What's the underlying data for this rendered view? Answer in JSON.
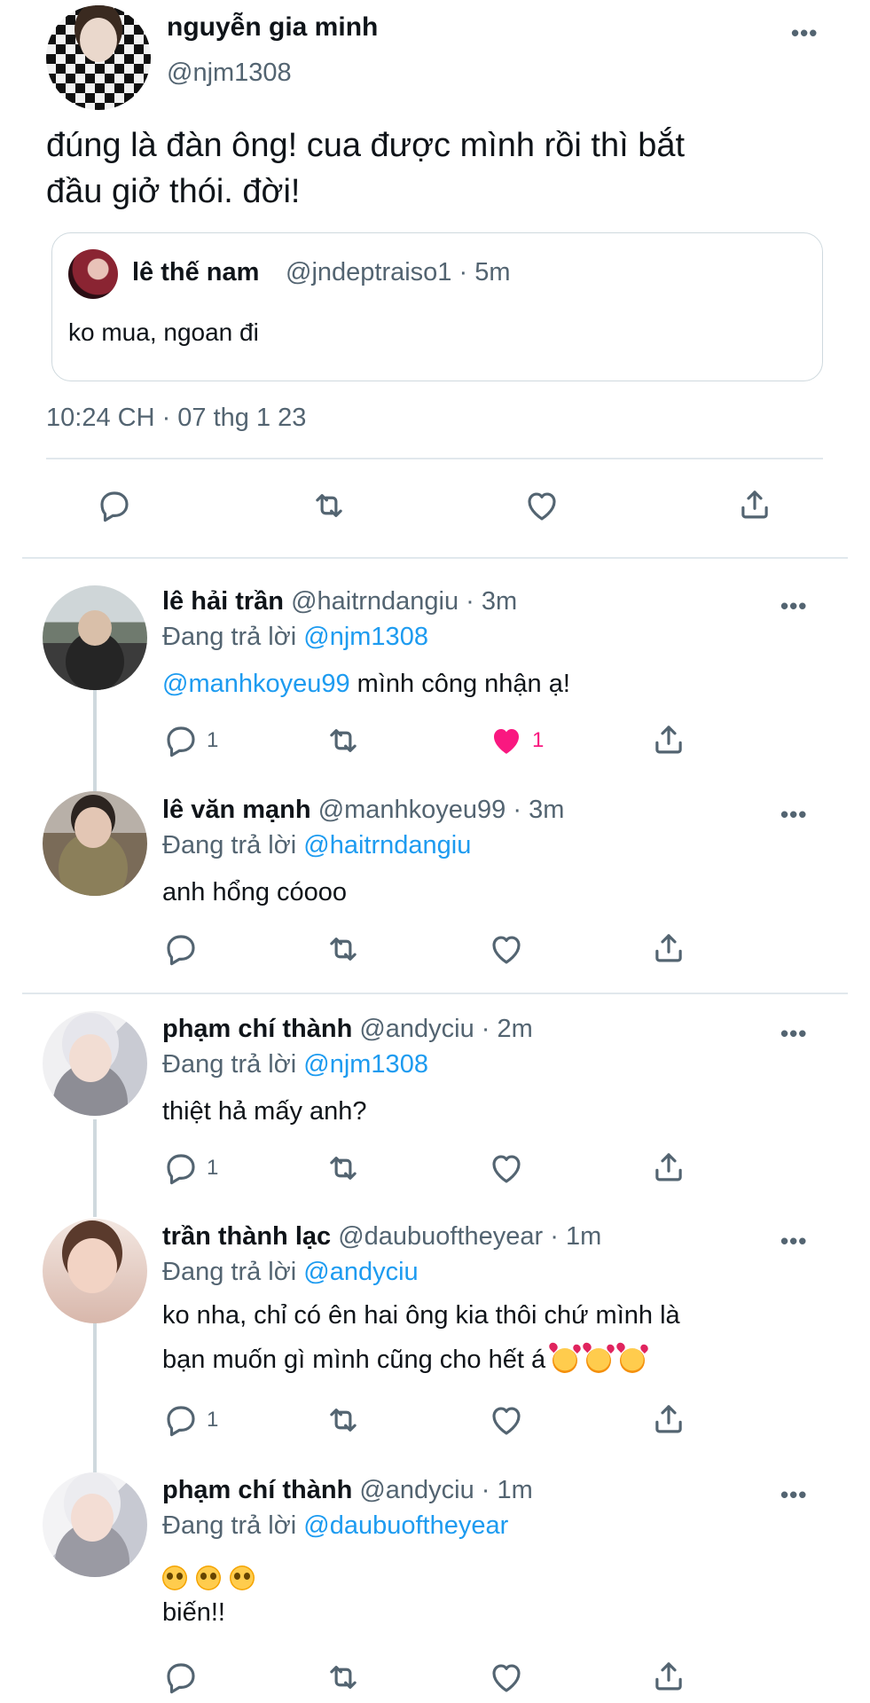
{
  "main_tweet": {
    "author_name": "nguyễn gia minh",
    "author_handle": "@njm1308",
    "more": "•••",
    "text_line1": "đúng là đàn ông! cua được mình rồi thì bắt",
    "text_line2": "đầu giở thói. đời!",
    "quote": {
      "author_name": "lê thế nam",
      "author_meta": "@jndeptraiso1 · 5m",
      "text": "ko mua, ngoan đi"
    },
    "timestamp": "10:24 CH · 07 thg 1 23"
  },
  "replies": [
    {
      "name": "lê hải trần",
      "handle_time": "@haitrndangiu · 3m",
      "replying_prefix": "Đang trả lời",
      "replying_to": "@njm1308",
      "text_mention": "@manhkoyeu99",
      "text": " mình công nhận ạ!",
      "reply_count": "1",
      "like_count": "1",
      "liked": true
    },
    {
      "name": "lê văn mạnh",
      "handle_time": "@manhkoyeu99 · 3m",
      "replying_prefix": "Đang trả lời",
      "replying_to": "@haitrndangiu",
      "text": "anh hổng cóooo"
    },
    {
      "name": "phạm chí thành",
      "handle_time": "@andyciu · 2m",
      "replying_prefix": "Đang trả lời",
      "replying_to": "@njm1308",
      "text": "thiệt hả mấy anh?",
      "reply_count": "1"
    },
    {
      "name": "trần thành lạc",
      "handle_time": "@daubuoftheyear · 1m",
      "replying_prefix": "Đang trả lời",
      "replying_to": "@andyciu",
      "text_line1": "ko nha, chỉ có ên hai ông kia thôi chứ mình là",
      "text_line2": "bạn muốn gì mình cũng cho hết á",
      "emoji": "smiling-face-with-hearts",
      "reply_count": "1"
    },
    {
      "name": "phạm chí thành",
      "handle_time": "@andyciu · 1m",
      "replying_prefix": "Đang trả lời",
      "replying_to": "@daubuoftheyear",
      "emoji": "pleading-face",
      "text": "biến!!"
    }
  ],
  "colors": {
    "link": "#1d9bf0",
    "muted": "#536471",
    "like": "#f91880",
    "divider": "#e1e8ed"
  }
}
